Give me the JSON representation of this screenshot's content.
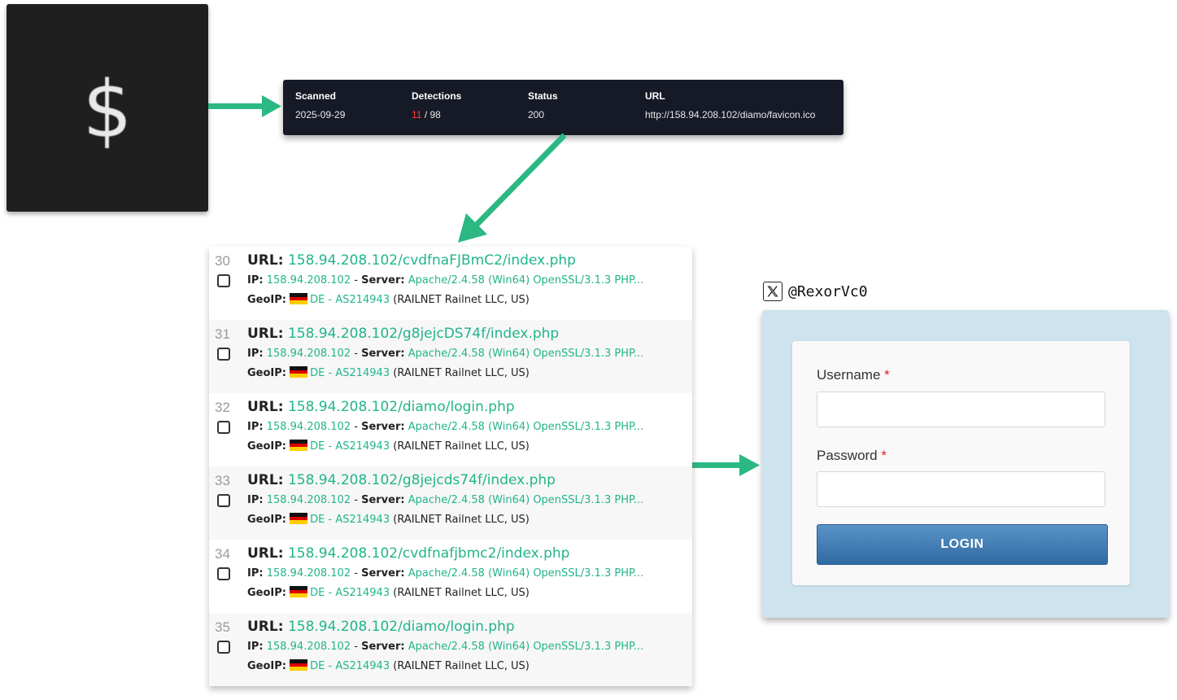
{
  "favicon": {
    "glyph": "$",
    "icon": "dollar-icon"
  },
  "scan": {
    "headers": {
      "scanned": "Scanned",
      "detections": "Detections",
      "status": "Status",
      "url": "URL"
    },
    "values": {
      "scanned": "2025-09-29",
      "detections_hits": "11",
      "detections_total": "/ 98",
      "status": "200",
      "url": "http://158.94.208.102/diamo/favicon.ico"
    }
  },
  "results": {
    "labels": {
      "url": "URL:",
      "ip": "IP:",
      "server": "Server:",
      "geoip": "GeoIP:",
      "sep": " - "
    },
    "items": [
      {
        "num": "30",
        "url": "158.94.208.102/cvdfnaFJBmC2/index.php",
        "ip": "158.94.208.102",
        "server": "Apache/2.4.58 (Win64) OpenSSL/3.1.3 PHP...",
        "country": "DE",
        "asn": "AS214943",
        "org": " (RAILNET Railnet LLC, US)"
      },
      {
        "num": "31",
        "url": "158.94.208.102/g8jejcDS74f/index.php",
        "ip": "158.94.208.102",
        "server": "Apache/2.4.58 (Win64) OpenSSL/3.1.3 PHP...",
        "country": "DE",
        "asn": "AS214943",
        "org": " (RAILNET Railnet LLC, US)"
      },
      {
        "num": "32",
        "url": "158.94.208.102/diamo/login.php",
        "ip": "158.94.208.102",
        "server": "Apache/2.4.58 (Win64) OpenSSL/3.1.3 PHP...",
        "country": "DE",
        "asn": "AS214943",
        "org": " (RAILNET Railnet LLC, US)"
      },
      {
        "num": "33",
        "url": "158.94.208.102/g8jejcds74f/index.php",
        "ip": "158.94.208.102",
        "server": "Apache/2.4.58 (Win64) OpenSSL/3.1.3 PHP...",
        "country": "DE",
        "asn": "AS214943",
        "org": " (RAILNET Railnet LLC, US)"
      },
      {
        "num": "34",
        "url": "158.94.208.102/cvdfnafjbmc2/index.php",
        "ip": "158.94.208.102",
        "server": "Apache/2.4.58 (Win64) OpenSSL/3.1.3 PHP...",
        "country": "DE",
        "asn": "AS214943",
        "org": " (RAILNET Railnet LLC, US)"
      },
      {
        "num": "35",
        "url": "158.94.208.102/diamo/login.php",
        "ip": "158.94.208.102",
        "server": "Apache/2.4.58 (Win64) OpenSSL/3.1.3 PHP...",
        "country": "DE",
        "asn": "AS214943",
        "org": " (RAILNET Railnet LLC, US)"
      }
    ]
  },
  "handle": {
    "text": "@RexorVc0",
    "icon": "x-logo-icon"
  },
  "login": {
    "username_label": "Username",
    "password_label": "Password",
    "required_mark": "*",
    "button_label": "LOGIN",
    "username_value": "",
    "password_value": ""
  },
  "colors": {
    "link": "#21b58a",
    "arrow": "#2bb883",
    "card_bg": "#161a26",
    "login_bg": "#cde3ed",
    "button": "#3d7ab3"
  }
}
